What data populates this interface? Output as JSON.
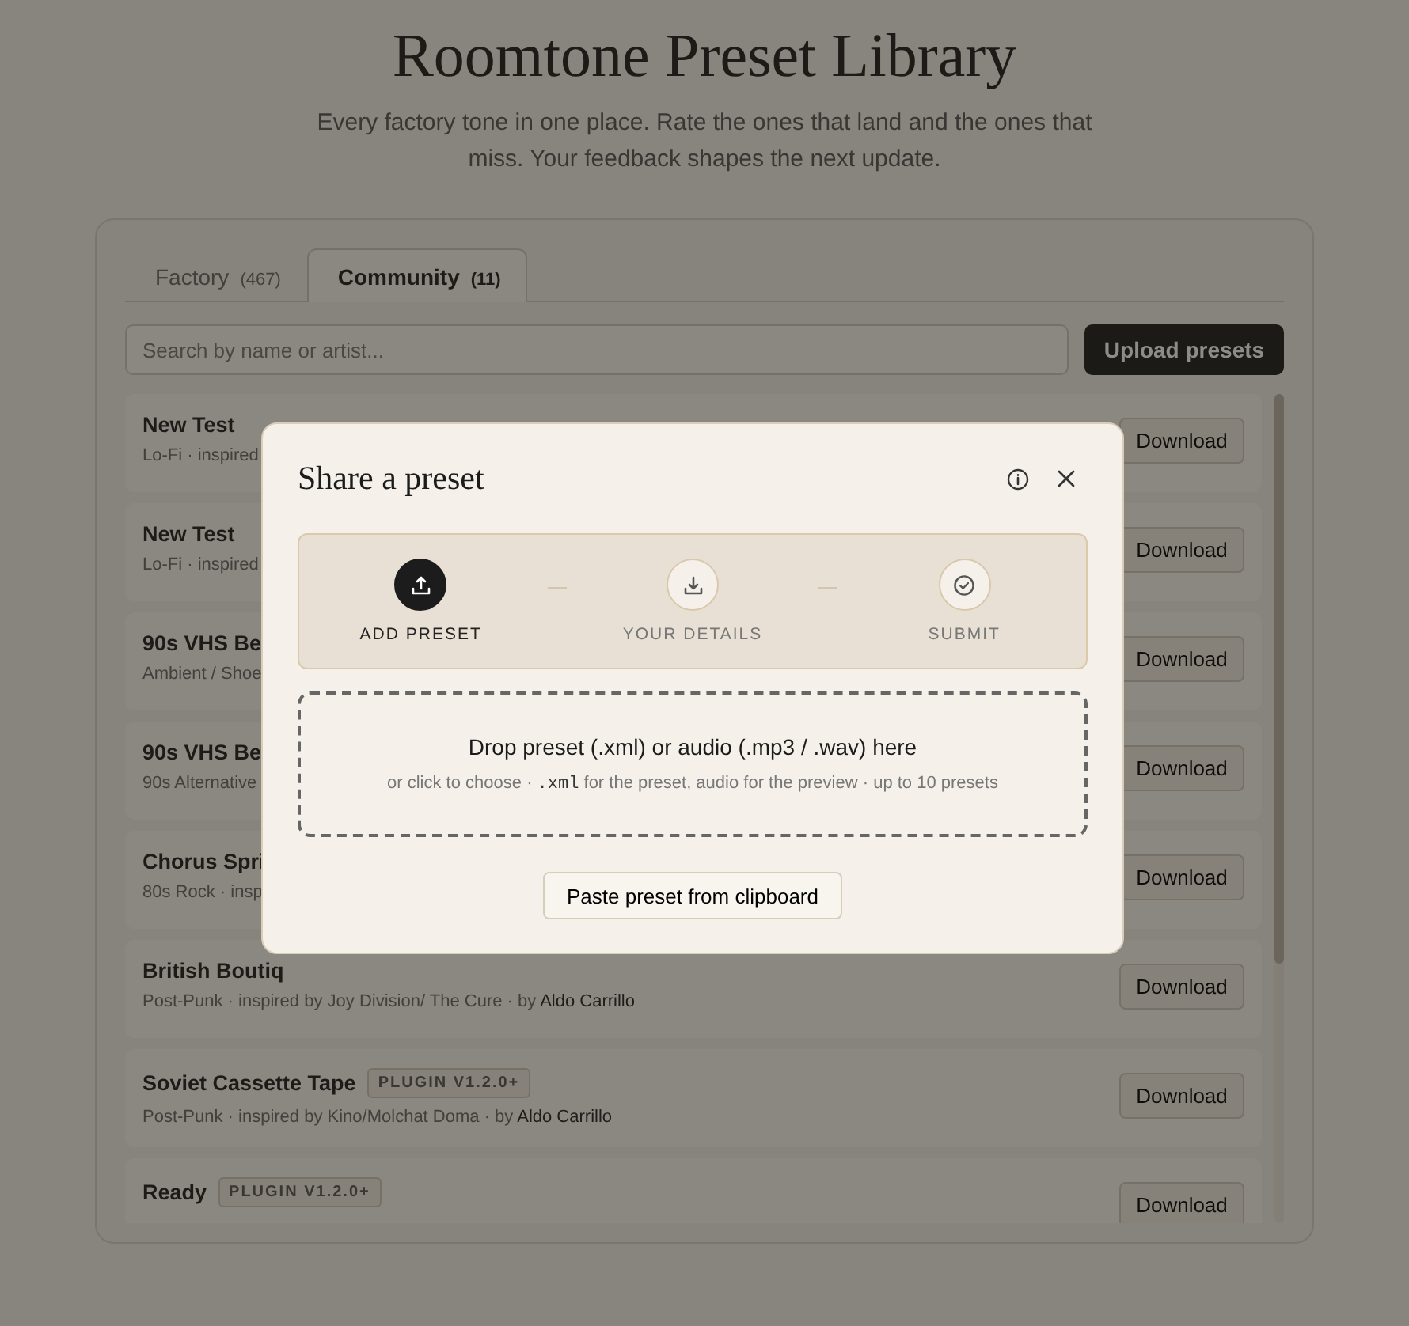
{
  "page": {
    "title": "Roomtone Preset Library",
    "subtitle": "Every factory tone in one place. Rate the ones that land and the ones that miss. Your feedback shapes the next update."
  },
  "tabs": [
    {
      "label": "Factory",
      "count": "(467)",
      "selected": false
    },
    {
      "label": "Community",
      "count": "(11)",
      "selected": true
    }
  ],
  "search": {
    "placeholder": "Search by name or artist..."
  },
  "upload_button": "Upload presets",
  "presets": [
    {
      "name": "New Test",
      "meta": "Lo-Fi · inspired",
      "button": "Download"
    },
    {
      "name": "New Test",
      "meta": "Lo-Fi · inspired",
      "button": "Download"
    },
    {
      "name": "90s VHS Be",
      "meta": "Ambient / Shoe",
      "button": "Download"
    },
    {
      "name": "90s VHS Be",
      "meta": "90s Alternative",
      "button": "Download"
    },
    {
      "name": "Chorus Spri",
      "meta": "80s Rock · insp",
      "button": "Download"
    },
    {
      "name": "British Boutiq",
      "meta": "Post-Punk · inspired by Joy Division/ The Cure · by ",
      "author": "Aldo Carrillo",
      "button": "Download"
    },
    {
      "name": "Soviet Cassette Tape",
      "badge": "PLUGIN V1.2.0+",
      "meta": "Post-Punk · inspired by Kino/Molchat Doma · by ",
      "author": "Aldo Carrillo",
      "button": "Download"
    },
    {
      "name": "Ready",
      "badge": "PLUGIN V1.2.0+",
      "button": "Download"
    }
  ],
  "modal": {
    "title": "Share a preset",
    "steps": [
      {
        "label": "ADD PRESET",
        "kind": "upload",
        "selected": true
      },
      {
        "label": "YOUR DETAILS",
        "kind": "download",
        "selected": false
      },
      {
        "label": "SUBMIT",
        "kind": "check",
        "selected": false
      }
    ],
    "drop_title": "Drop preset (.xml) or audio (.mp3 / .wav) here",
    "drop_hint": [
      {
        "text": "or click to choose · ",
        "kind": "plain"
      },
      {
        "text": ".xml",
        "kind": "code"
      },
      {
        "text": " for the preset, audio for the preview · up to 10 presets",
        "kind": "plain"
      }
    ],
    "paste_button": "Paste preset from clipboard"
  }
}
